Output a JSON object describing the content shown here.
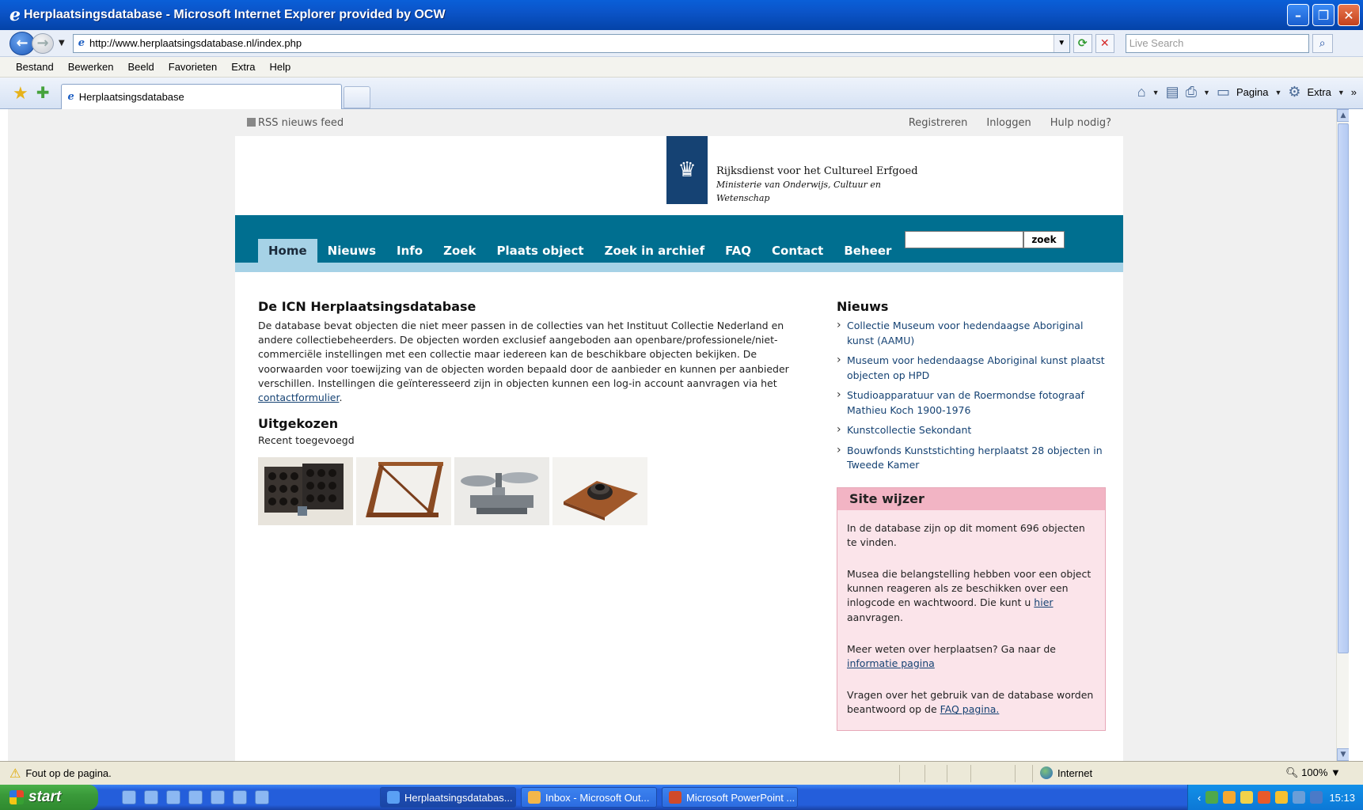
{
  "window": {
    "title": "Herplaatsingsdatabase - Microsoft Internet Explorer provided by OCW"
  },
  "addressbar": {
    "url": "http://www.herplaatsingsdatabase.nl/index.php",
    "search_placeholder": "Live Search"
  },
  "menubar": {
    "items": [
      "Bestand",
      "Bewerken",
      "Beeld",
      "Favorieten",
      "Extra",
      "Help"
    ]
  },
  "tabbar": {
    "tab_title": "Herplaatsingsdatabase",
    "page_label": "Pagina",
    "tools_label": "Extra"
  },
  "site": {
    "rss": "RSS nieuws feed",
    "top_links": [
      "Registreren",
      "Inloggen",
      "Hulp nodig?"
    ],
    "logo": {
      "line1": "Rijksdienst voor het Cultureel Erfgoed",
      "line2": "Ministerie van Onderwijs, Cultuur en",
      "line3": "Wetenschap"
    },
    "nav": [
      "Home",
      "Nieuws",
      "Info",
      "Zoek",
      "Plaats object",
      "Zoek in archief",
      "FAQ",
      "Contact",
      "Beheer"
    ],
    "search_button": "zoek"
  },
  "main": {
    "title": "De ICN Herplaatsingsdatabase",
    "intro": "De database bevat objecten die niet meer passen in de collecties van het Instituut Collectie Nederland en andere collectiebeheerders. De objecten worden exclusief aangeboden aan openbare/professionele/niet-commerciële instellingen met een collectie maar iedereen kan de beschikbare objecten bekijken. De voorwaarden voor toewijzing van de objecten worden bepaald door de aanbieder en kunnen per aanbieder verschillen. Instellingen die geïnteresseerd zijn in objecten kunnen een log-in account aanvragen via het",
    "intro_link": "contactformulier",
    "intro_end": ".",
    "featured_title": "Uitgekozen",
    "featured_sub": "Recent toegevoegd"
  },
  "sidebar": {
    "news_title": "Nieuws",
    "news": [
      "Collectie Museum voor hedendaagse Aboriginal kunst (AAMU)",
      "Museum voor hedendaagse Aboriginal kunst plaatst objecten op HPD",
      "Studioapparatuur van de Roermondse fotograaf Mathieu Koch 1900-1976",
      "Kunstcollectie Sekondant",
      "Bouwfonds Kunststichting herplaatst 28 objecten in Tweede Kamer"
    ],
    "sitewijzer": {
      "title": "Site wijzer",
      "p1": "In de database zijn op dit moment 696 objecten te vinden.",
      "p2_pre": "Musea die belangstelling hebben voor een object kunnen reageren als ze beschikken over een inlogcode en wachtwoord. Die kunt u",
      "p2_link": "hier",
      "p2_post": "aanvragen.",
      "p3_pre": "Meer weten over herplaatsen? Ga naar de",
      "p3_link": "informatie pagina",
      "p4_pre": "Vragen over het gebruik van de database worden beantwoord op de",
      "p4_link": "FAQ pagina."
    }
  },
  "statusbar": {
    "message": "Fout op de pagina.",
    "zone": "Internet",
    "zoom": "100%"
  },
  "taskbar": {
    "start": "start",
    "tasks": [
      "Herplaatsingsdatabas...",
      "Inbox - Microsoft Out...",
      "Microsoft PowerPoint ..."
    ],
    "clock": "15:13"
  }
}
